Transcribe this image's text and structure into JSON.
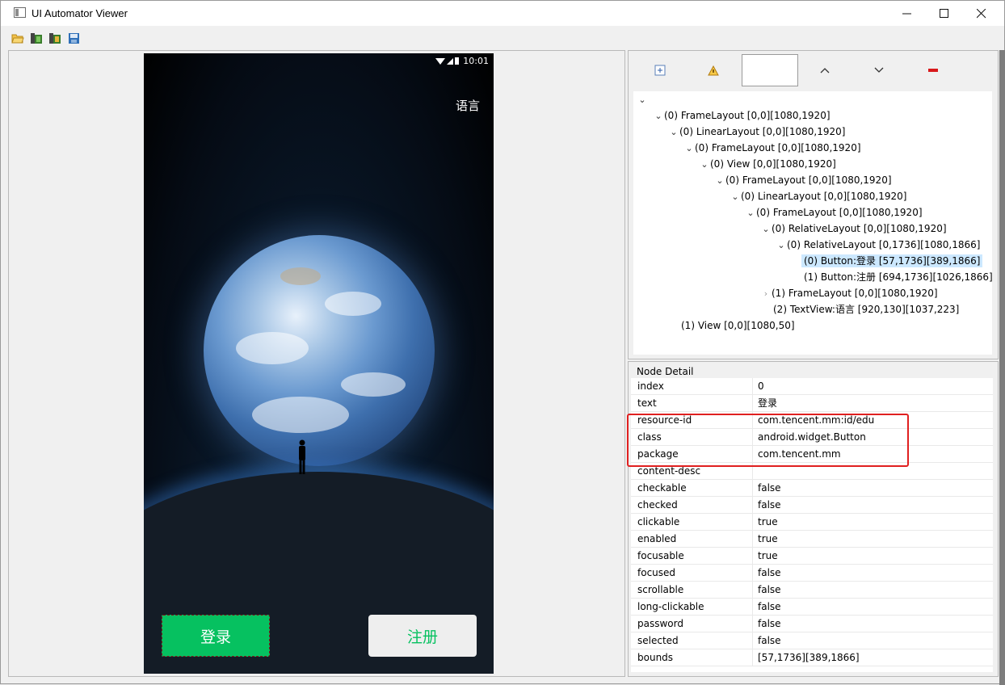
{
  "window": {
    "title": "UI Automator Viewer"
  },
  "toolbar": {
    "items": [
      "open-folder-icon",
      "device-screenshot-icon",
      "device-screenshot-compressed-icon",
      "save-icon"
    ]
  },
  "device": {
    "status_time": "10:01",
    "language": "语言",
    "login_label": "登录",
    "register_label": "注册"
  },
  "hierarchy_toolbar": {
    "items": [
      "expand-all-icon",
      "warning-icon",
      "filter-box",
      "up-icon",
      "down-icon",
      "collapse-icon"
    ]
  },
  "tree": [
    {
      "label": "(0) FrameLayout [0,0][1080,1920]"
    },
    {
      "label": "(0) LinearLayout [0,0][1080,1920]"
    },
    {
      "label": "(0) FrameLayout [0,0][1080,1920]"
    },
    {
      "label": "(0) View [0,0][1080,1920]"
    },
    {
      "label": "(0) FrameLayout [0,0][1080,1920]"
    },
    {
      "label": "(0) LinearLayout [0,0][1080,1920]"
    },
    {
      "label": "(0) FrameLayout [0,0][1080,1920]"
    },
    {
      "label": "(0) RelativeLayout [0,0][1080,1920]"
    },
    {
      "label": "(0) RelativeLayout [0,1736][1080,1866]"
    },
    {
      "label": "(0) Button:登录 [57,1736][389,1866]"
    },
    {
      "label": "(1) Button:注册 [694,1736][1026,1866]"
    },
    {
      "label": "(1) FrameLayout [0,0][1080,1920]"
    },
    {
      "label": "(2) TextView:语言 [920,130][1037,223]"
    },
    {
      "label": "(1) View [0,0][1080,50]"
    }
  ],
  "node_detail": {
    "title": "Node Detail",
    "rows": [
      {
        "key": "index",
        "value": "0"
      },
      {
        "key": "text",
        "value": "登录"
      },
      {
        "key": "resource-id",
        "value": "com.tencent.mm:id/edu"
      },
      {
        "key": "class",
        "value": "android.widget.Button"
      },
      {
        "key": "package",
        "value": "com.tencent.mm"
      },
      {
        "key": "content-desc",
        "value": ""
      },
      {
        "key": "checkable",
        "value": "false"
      },
      {
        "key": "checked",
        "value": "false"
      },
      {
        "key": "clickable",
        "value": "true"
      },
      {
        "key": "enabled",
        "value": "true"
      },
      {
        "key": "focusable",
        "value": "true"
      },
      {
        "key": "focused",
        "value": "false"
      },
      {
        "key": "scrollable",
        "value": "false"
      },
      {
        "key": "long-clickable",
        "value": "false"
      },
      {
        "key": "password",
        "value": "false"
      },
      {
        "key": "selected",
        "value": "false"
      },
      {
        "key": "bounds",
        "value": "[57,1736][389,1866]"
      }
    ]
  },
  "colors": {
    "accent_green": "#06c160",
    "highlight_red": "#e02020",
    "selection": "#cce8ff"
  }
}
